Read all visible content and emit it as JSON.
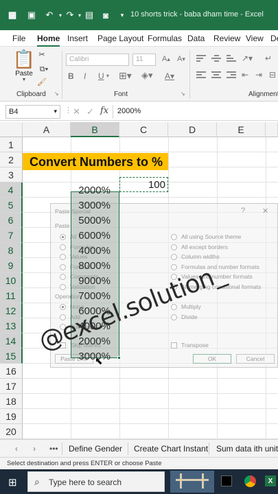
{
  "window": {
    "title": "10 shorts trick - baba dham time  -  Excel",
    "accent": "#217346"
  },
  "tabs": [
    "File",
    "Home",
    "Insert",
    "Page Layout",
    "Formulas",
    "Data",
    "Review",
    "View",
    "De"
  ],
  "ribbon": {
    "paste_label": "Paste",
    "font_name": "Calibri",
    "font_size": "11",
    "group_clipboard": "Clipboard",
    "group_font": "Font",
    "group_alignment": "Alignment",
    "bold": "B",
    "italic": "I",
    "underline": "U"
  },
  "formula_bar": {
    "name_box": "B4",
    "fx": "fx",
    "value": "2000%"
  },
  "columns": [
    "A",
    "B",
    "C",
    "D",
    "E"
  ],
  "rows": [
    "1",
    "2",
    "3",
    "4",
    "5",
    "6",
    "7",
    "8",
    "9",
    "10",
    "11",
    "12",
    "13",
    "14",
    "15",
    "16",
    "17",
    "18",
    "19",
    "20"
  ],
  "cells": {
    "title": "Convert Numbers to %",
    "c4": "100",
    "column_b": [
      "2000%",
      "3000%",
      "5000%",
      "6000%",
      "4000%",
      "8000%",
      "9000%",
      "7000%",
      "6000%",
      "4000%",
      "2000%",
      "3000%"
    ]
  },
  "dialog": {
    "title": "Paste Special",
    "help": "?",
    "close": "✕",
    "paste_section": "Paste",
    "paste_left": [
      "All",
      "Formulas",
      "Values",
      "Formats",
      "Comments",
      "Validation"
    ],
    "paste_right": [
      "All using Source theme",
      "All except borders",
      "Column widths",
      "Formulas and number formats",
      "Values and number formats",
      "All merging conditional formats"
    ],
    "operation_section": "Operation",
    "operation_left": [
      "None",
      "Add",
      "Subtract"
    ],
    "operation_right": [
      "Multiply",
      "Divide"
    ],
    "skip_blanks": "Skip blanks",
    "transpose": "Transpose",
    "paste_link": "Paste Link",
    "ok": "OK",
    "cancel": "Cancel"
  },
  "sheet_tabs": [
    "Define Gender",
    "Create Chart Instant",
    "Sum data ith units"
  ],
  "status_text": "Select destination and press ENTER or choose Paste",
  "taskbar": {
    "search_placeholder": "Type here to search"
  },
  "watermark": "@excel.solution_"
}
